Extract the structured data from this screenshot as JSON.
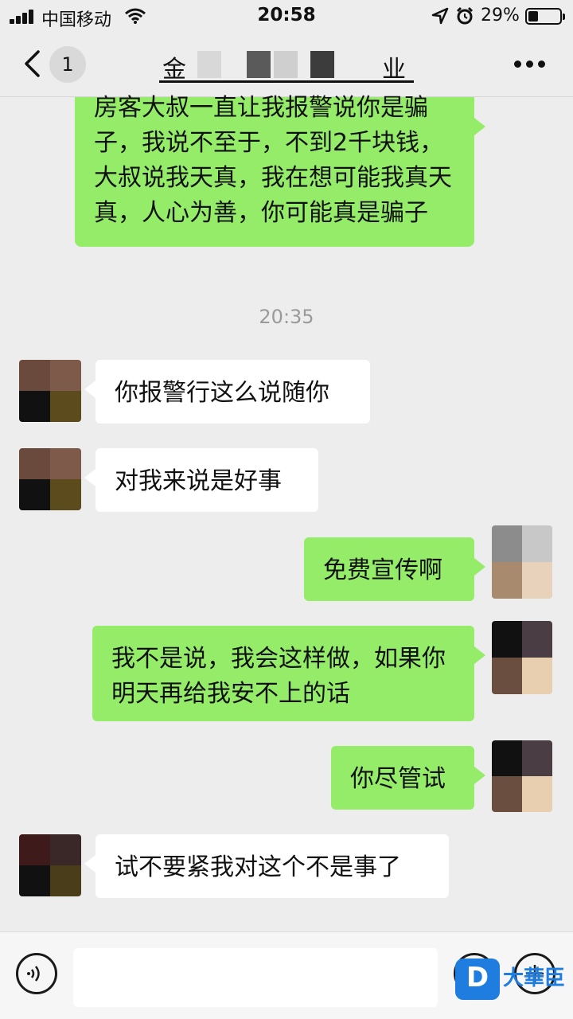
{
  "status_bar": {
    "carrier": "中国移动",
    "time": "20:58",
    "battery": "29%"
  },
  "nav": {
    "unread_count": "1",
    "title_first": "金",
    "title_last": "业"
  },
  "messages": [
    {
      "side": "out",
      "text": "房客大叔一直让我报警说你是骗子，我说不至于，不到2千块钱，大叔说我天真，我在想可能我真天真，人心为善，你可能真是骗子"
    },
    {
      "side": "in",
      "text": "你报警行这么说随你"
    },
    {
      "side": "in",
      "text": "对我来说是好事"
    },
    {
      "side": "out",
      "text": "免费宣传啊"
    },
    {
      "side": "out",
      "text": "我不是说，我会这样做，如果你明天再给我安不上的话"
    },
    {
      "side": "out",
      "text": "你尽管试"
    },
    {
      "side": "in",
      "text": "试不要紧我对这个不是事了"
    }
  ],
  "timestamp": "20:35",
  "watermark": {
    "text": "大華臣",
    "logo_letter": "D"
  },
  "icons": {
    "back": "chevron-left-icon",
    "more": "ellipsis-icon",
    "voice": "voice-icon",
    "emoji": "emoji-icon",
    "plus": "plus-icon"
  },
  "colors": {
    "outgoing_bubble": "#95ec69",
    "incoming_bubble": "#ffffff",
    "background": "#ededed"
  }
}
